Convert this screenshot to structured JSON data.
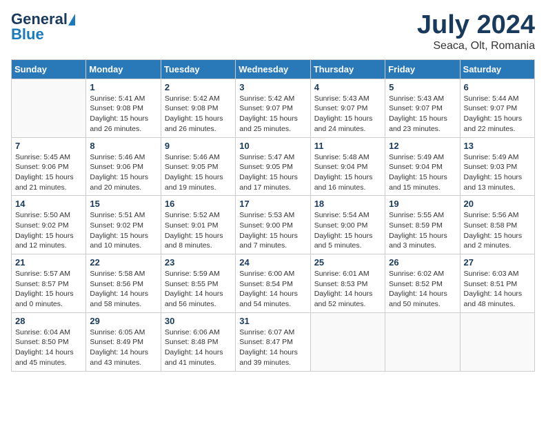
{
  "header": {
    "logo_line1": "General",
    "logo_line2": "Blue",
    "month": "July 2024",
    "location": "Seaca, Olt, Romania"
  },
  "weekdays": [
    "Sunday",
    "Monday",
    "Tuesday",
    "Wednesday",
    "Thursday",
    "Friday",
    "Saturday"
  ],
  "weeks": [
    [
      {
        "day": "",
        "info": ""
      },
      {
        "day": "1",
        "info": "Sunrise: 5:41 AM\nSunset: 9:08 PM\nDaylight: 15 hours\nand 26 minutes."
      },
      {
        "day": "2",
        "info": "Sunrise: 5:42 AM\nSunset: 9:08 PM\nDaylight: 15 hours\nand 26 minutes."
      },
      {
        "day": "3",
        "info": "Sunrise: 5:42 AM\nSunset: 9:07 PM\nDaylight: 15 hours\nand 25 minutes."
      },
      {
        "day": "4",
        "info": "Sunrise: 5:43 AM\nSunset: 9:07 PM\nDaylight: 15 hours\nand 24 minutes."
      },
      {
        "day": "5",
        "info": "Sunrise: 5:43 AM\nSunset: 9:07 PM\nDaylight: 15 hours\nand 23 minutes."
      },
      {
        "day": "6",
        "info": "Sunrise: 5:44 AM\nSunset: 9:07 PM\nDaylight: 15 hours\nand 22 minutes."
      }
    ],
    [
      {
        "day": "7",
        "info": "Sunrise: 5:45 AM\nSunset: 9:06 PM\nDaylight: 15 hours\nand 21 minutes."
      },
      {
        "day": "8",
        "info": "Sunrise: 5:46 AM\nSunset: 9:06 PM\nDaylight: 15 hours\nand 20 minutes."
      },
      {
        "day": "9",
        "info": "Sunrise: 5:46 AM\nSunset: 9:05 PM\nDaylight: 15 hours\nand 19 minutes."
      },
      {
        "day": "10",
        "info": "Sunrise: 5:47 AM\nSunset: 9:05 PM\nDaylight: 15 hours\nand 17 minutes."
      },
      {
        "day": "11",
        "info": "Sunrise: 5:48 AM\nSunset: 9:04 PM\nDaylight: 15 hours\nand 16 minutes."
      },
      {
        "day": "12",
        "info": "Sunrise: 5:49 AM\nSunset: 9:04 PM\nDaylight: 15 hours\nand 15 minutes."
      },
      {
        "day": "13",
        "info": "Sunrise: 5:49 AM\nSunset: 9:03 PM\nDaylight: 15 hours\nand 13 minutes."
      }
    ],
    [
      {
        "day": "14",
        "info": "Sunrise: 5:50 AM\nSunset: 9:02 PM\nDaylight: 15 hours\nand 12 minutes."
      },
      {
        "day": "15",
        "info": "Sunrise: 5:51 AM\nSunset: 9:02 PM\nDaylight: 15 hours\nand 10 minutes."
      },
      {
        "day": "16",
        "info": "Sunrise: 5:52 AM\nSunset: 9:01 PM\nDaylight: 15 hours\nand 8 minutes."
      },
      {
        "day": "17",
        "info": "Sunrise: 5:53 AM\nSunset: 9:00 PM\nDaylight: 15 hours\nand 7 minutes."
      },
      {
        "day": "18",
        "info": "Sunrise: 5:54 AM\nSunset: 9:00 PM\nDaylight: 15 hours\nand 5 minutes."
      },
      {
        "day": "19",
        "info": "Sunrise: 5:55 AM\nSunset: 8:59 PM\nDaylight: 15 hours\nand 3 minutes."
      },
      {
        "day": "20",
        "info": "Sunrise: 5:56 AM\nSunset: 8:58 PM\nDaylight: 15 hours\nand 2 minutes."
      }
    ],
    [
      {
        "day": "21",
        "info": "Sunrise: 5:57 AM\nSunset: 8:57 PM\nDaylight: 15 hours\nand 0 minutes."
      },
      {
        "day": "22",
        "info": "Sunrise: 5:58 AM\nSunset: 8:56 PM\nDaylight: 14 hours\nand 58 minutes."
      },
      {
        "day": "23",
        "info": "Sunrise: 5:59 AM\nSunset: 8:55 PM\nDaylight: 14 hours\nand 56 minutes."
      },
      {
        "day": "24",
        "info": "Sunrise: 6:00 AM\nSunset: 8:54 PM\nDaylight: 14 hours\nand 54 minutes."
      },
      {
        "day": "25",
        "info": "Sunrise: 6:01 AM\nSunset: 8:53 PM\nDaylight: 14 hours\nand 52 minutes."
      },
      {
        "day": "26",
        "info": "Sunrise: 6:02 AM\nSunset: 8:52 PM\nDaylight: 14 hours\nand 50 minutes."
      },
      {
        "day": "27",
        "info": "Sunrise: 6:03 AM\nSunset: 8:51 PM\nDaylight: 14 hours\nand 48 minutes."
      }
    ],
    [
      {
        "day": "28",
        "info": "Sunrise: 6:04 AM\nSunset: 8:50 PM\nDaylight: 14 hours\nand 45 minutes."
      },
      {
        "day": "29",
        "info": "Sunrise: 6:05 AM\nSunset: 8:49 PM\nDaylight: 14 hours\nand 43 minutes."
      },
      {
        "day": "30",
        "info": "Sunrise: 6:06 AM\nSunset: 8:48 PM\nDaylight: 14 hours\nand 41 minutes."
      },
      {
        "day": "31",
        "info": "Sunrise: 6:07 AM\nSunset: 8:47 PM\nDaylight: 14 hours\nand 39 minutes."
      },
      {
        "day": "",
        "info": ""
      },
      {
        "day": "",
        "info": ""
      },
      {
        "day": "",
        "info": ""
      }
    ]
  ]
}
